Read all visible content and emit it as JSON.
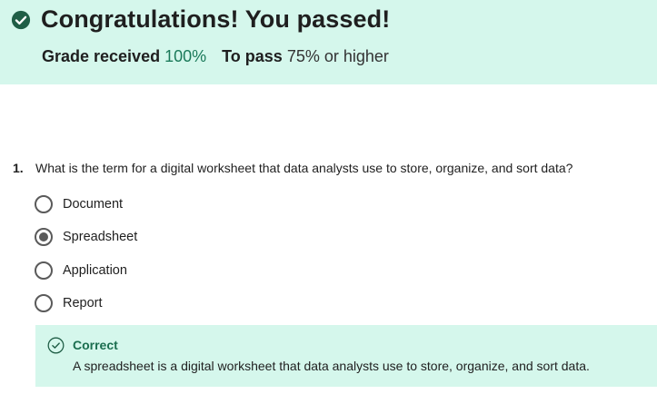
{
  "banner": {
    "title": "Congratulations! You passed!",
    "grade_label": "Grade received",
    "grade_value": "100%",
    "pass_label": "To pass",
    "pass_value": "75% or higher",
    "icon": "check-circle-icon"
  },
  "question": {
    "number": "1.",
    "text": "What is the term for a digital worksheet that data analysts use to store, organize, and sort data?",
    "options": [
      {
        "label": "Document",
        "selected": false
      },
      {
        "label": "Spreadsheet",
        "selected": true
      },
      {
        "label": "Application",
        "selected": false
      },
      {
        "label": "Report",
        "selected": false
      }
    ]
  },
  "feedback": {
    "status": "Correct",
    "text": "A spreadsheet is a digital worksheet that data analysts use to store, organize, and sort data.",
    "icon": "check-circle-outline-icon"
  },
  "colors": {
    "success_bg": "#d5f7ec",
    "success_text": "#1b7a5a",
    "icon_dark": "#1f5e46"
  }
}
